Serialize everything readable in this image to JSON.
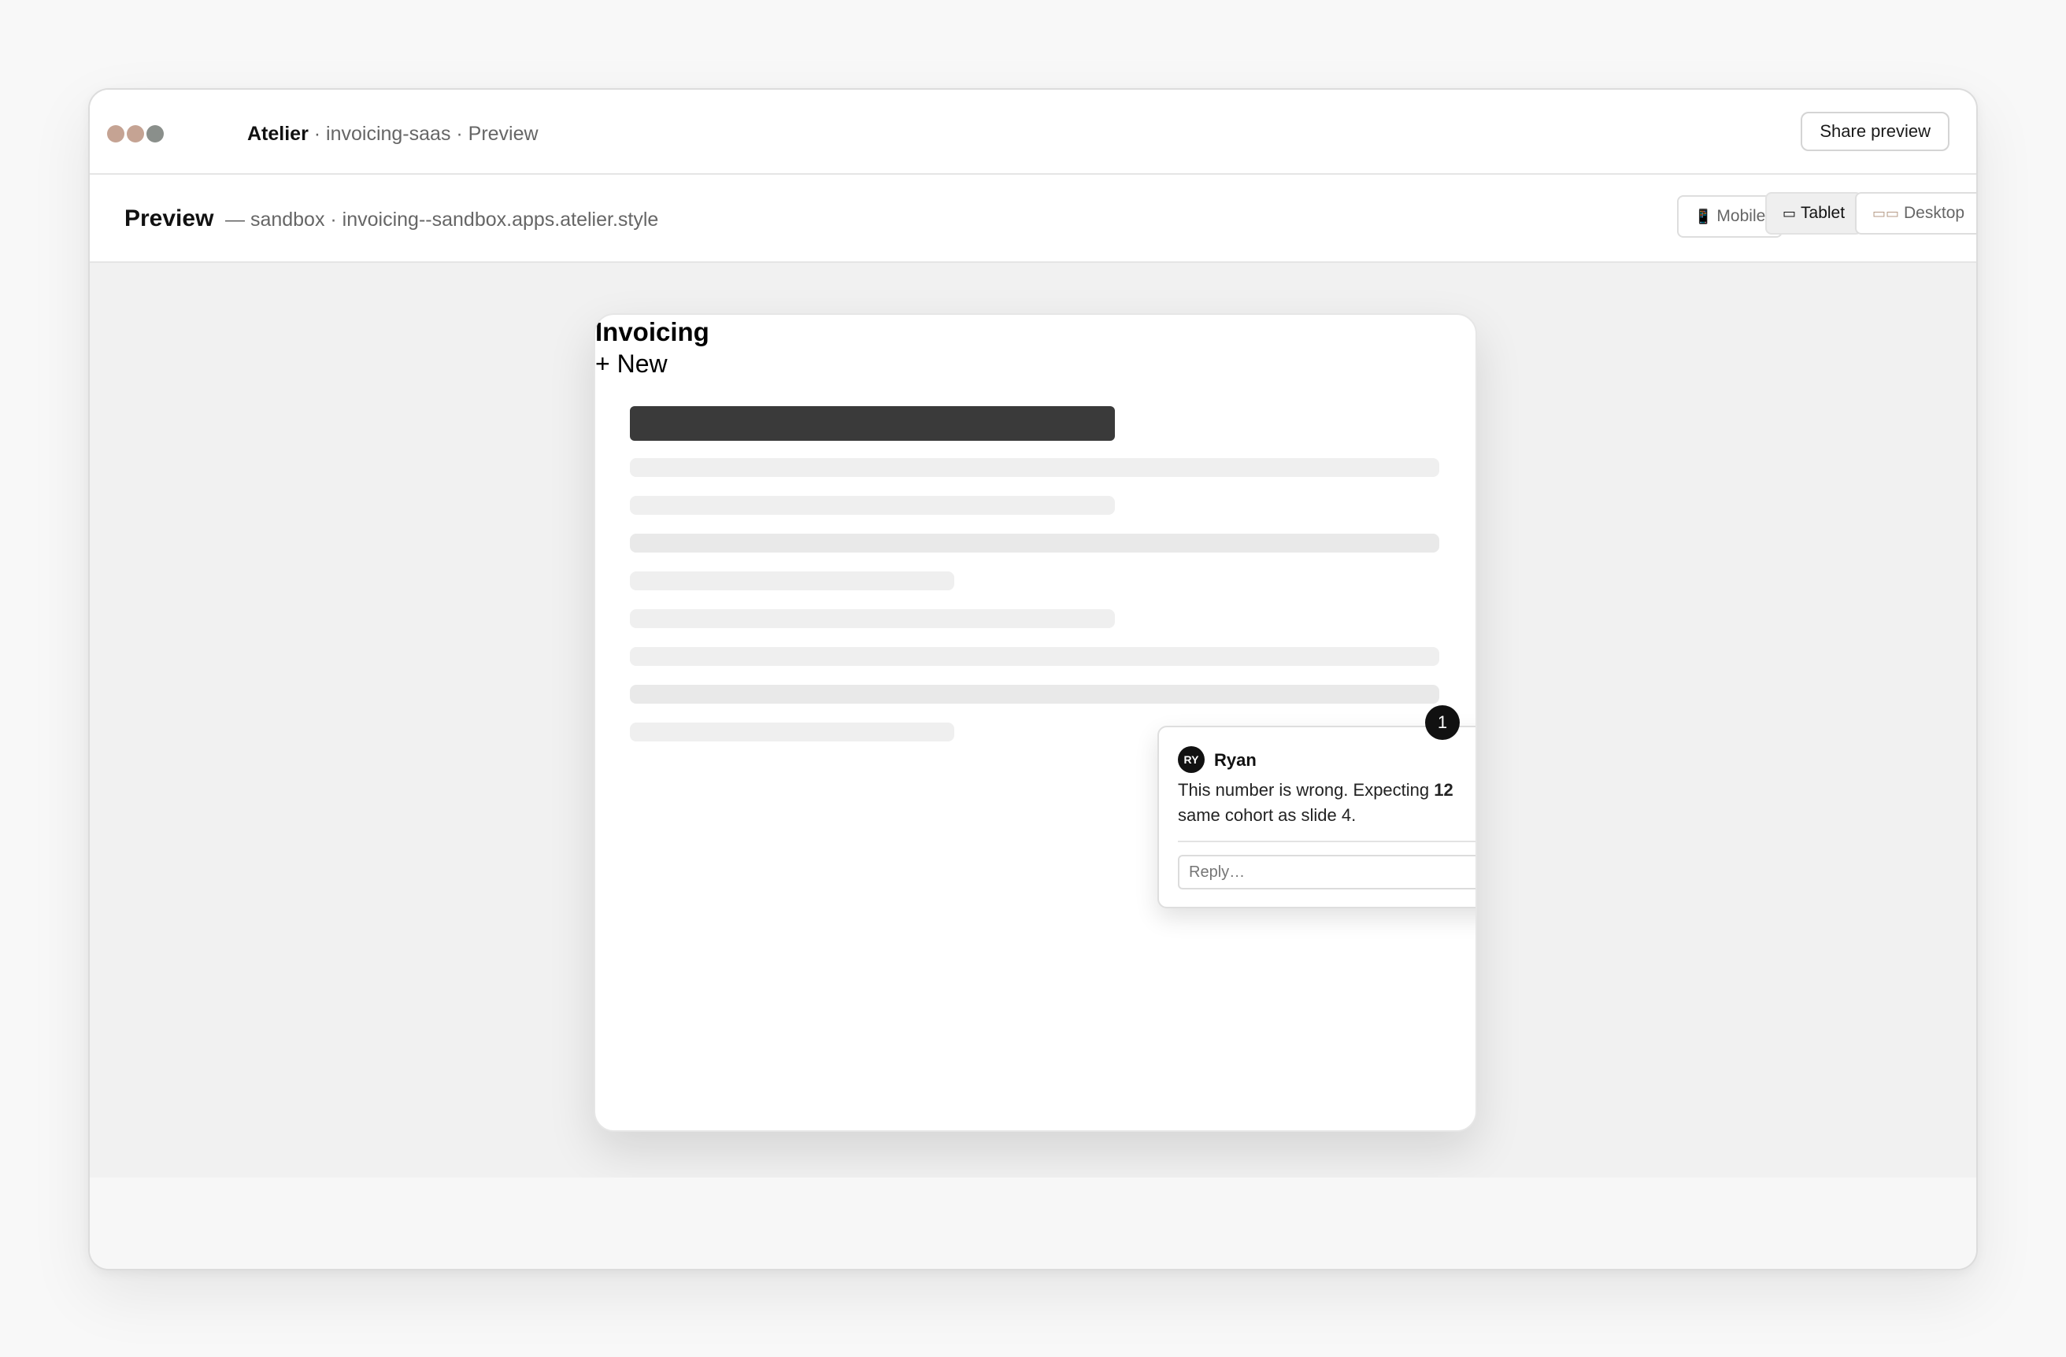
{
  "window": {
    "title_strong": "Atelier",
    "title_rest": " · invoicing-saas · Preview",
    "share_label": "Share preview",
    "traffic_colors": [
      "#c5a393",
      "#c5a393",
      "#8a8f8b"
    ]
  },
  "subbar": {
    "title": "Preview",
    "env": "— sandbox · invoicing--sandbox.apps.atelier.style",
    "devices": [
      {
        "label": "Mobile",
        "icon": "phone-icon",
        "active": false
      },
      {
        "label": "Tablet",
        "icon": "tablet-icon",
        "active": true
      },
      {
        "label": "Desktop",
        "icon": "desktop-icon",
        "active": false
      }
    ]
  },
  "app": {
    "heading": "Invoicing",
    "new_label": "+ New"
  },
  "comment": {
    "pin_number": "1",
    "avatar_initials": "RY",
    "author": "Ryan",
    "text_prefix": "This number is wrong. Expecting ",
    "text_bold": "12",
    "text_line2": "same cohort as slide 4.",
    "reply_placeholder": "Reply…"
  }
}
